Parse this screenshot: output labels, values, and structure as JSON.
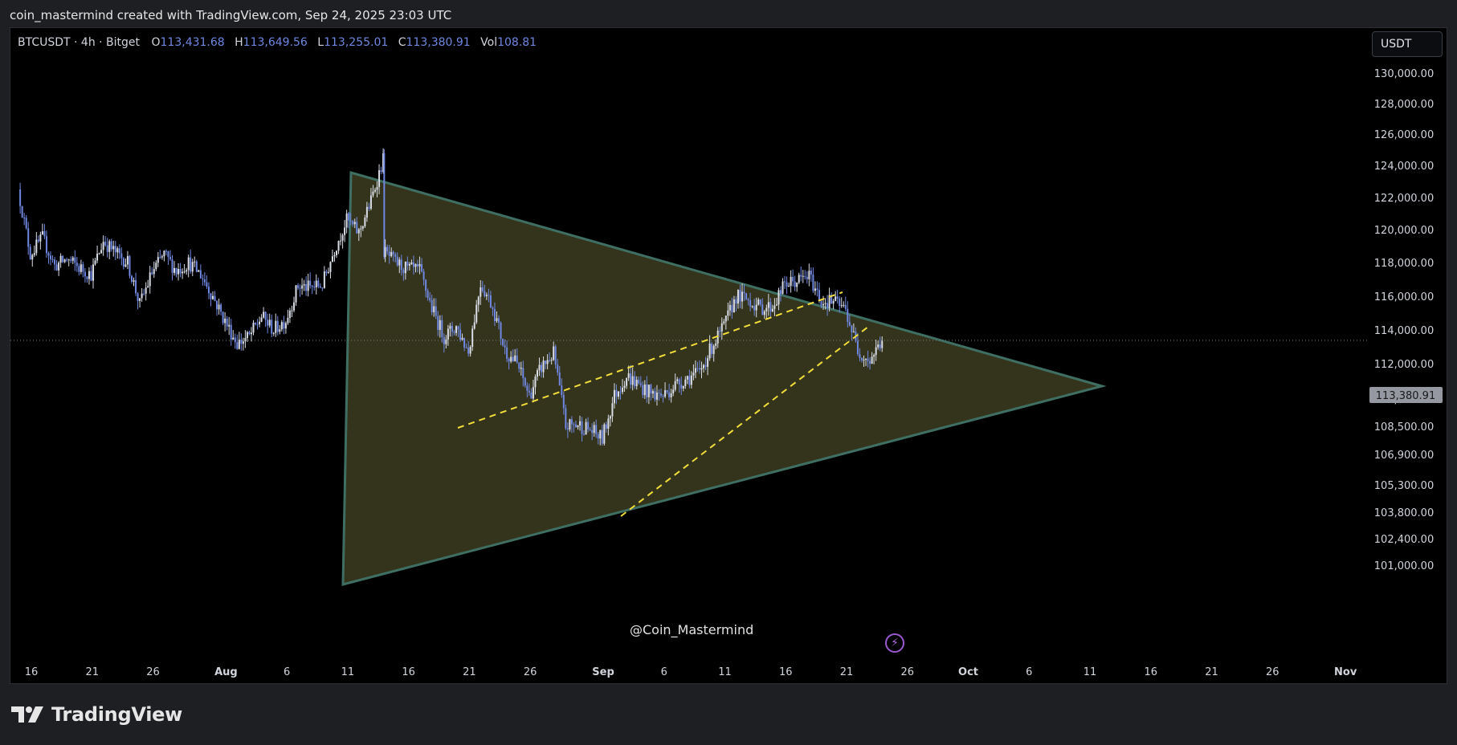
{
  "header": {
    "attribution": "coin_mastermind created with TradingView.com, Sep 24, 2025 23:03 UTC"
  },
  "symbol_info": {
    "symbol": "BTCUSDT · 4h · Bitget",
    "open_label": "O",
    "open": "113,431.68",
    "high_label": "H",
    "high": "113,649.56",
    "low_label": "L",
    "low": "113,255.01",
    "close_label": "C",
    "close": "113,380.91",
    "vol_label": "Vol",
    "vol": "108.81"
  },
  "currency_button": "USDT",
  "watermark": "@Coin_Mastermind",
  "logo": {
    "name": "TradingView",
    "icon": "tradingview-logo-icon"
  },
  "colors": {
    "background": "#000000",
    "candle": "#6f87e0",
    "candle_alt": "#d9dde6",
    "triangle_fill": "#3a3a20",
    "triangle_stroke": "#3f6f62",
    "dashed_line": "#f2dd3a",
    "price_line": "#7a7f88",
    "price_tag": "#9598a1"
  },
  "chart_data": {
    "type": "candlestick",
    "title": "BTCUSDT · 4h · Bitget",
    "timeframe": "4h",
    "y_ticks": [
      130000,
      128000,
      126000,
      124000,
      122000,
      120000,
      118000,
      116000,
      114000,
      112000,
      110000,
      108500,
      106900,
      105300,
      103800,
      102400,
      101000
    ],
    "y_tick_labels": [
      "130,000.00",
      "128,000.00",
      "126,000.00",
      "124,000.00",
      "122,000.00",
      "120,000.00",
      "118,000.00",
      "116,000.00",
      "114,000.00",
      "112,000.00",
      "110,000.00",
      "108,500.00",
      "106,900.00",
      "105,300.00",
      "103,800.00",
      "102,400.00",
      "101,000.00"
    ],
    "x_tick_labels": [
      "16",
      "21",
      "26",
      "Aug",
      "6",
      "11",
      "16",
      "21",
      "26",
      "Sep",
      "6",
      "11",
      "16",
      "21",
      "26",
      "Oct",
      "6",
      "11",
      "16",
      "21",
      "26",
      "Nov"
    ],
    "x_tick_dates": [
      "2025-07-16",
      "2025-07-21",
      "2025-07-26",
      "2025-08-01",
      "2025-08-06",
      "2025-08-11",
      "2025-08-16",
      "2025-08-21",
      "2025-08-26",
      "2025-09-01",
      "2025-09-06",
      "2025-09-11",
      "2025-09-16",
      "2025-09-21",
      "2025-09-26",
      "2025-10-01",
      "2025-10-06",
      "2025-10-11",
      "2025-10-16",
      "2025-10-21",
      "2025-10-26",
      "2025-11-01"
    ],
    "last_price": 113380.91,
    "last_price_label": "113,380.91",
    "price_path": [
      [
        "2025-07-15",
        122500
      ],
      [
        "2025-07-16",
        118500
      ],
      [
        "2025-07-17",
        119500
      ],
      [
        "2025-07-18",
        117800
      ],
      [
        "2025-07-19",
        118200
      ],
      [
        "2025-07-20",
        117700
      ],
      [
        "2025-07-21",
        117300
      ],
      [
        "2025-07-22",
        119300
      ],
      [
        "2025-07-23",
        118600
      ],
      [
        "2025-07-24",
        118000
      ],
      [
        "2025-07-25",
        115500
      ],
      [
        "2025-07-26",
        117400
      ],
      [
        "2025-07-27",
        118500
      ],
      [
        "2025-07-28",
        117500
      ],
      [
        "2025-07-29",
        118000
      ],
      [
        "2025-07-30",
        117300
      ],
      [
        "2025-07-31",
        116000
      ],
      [
        "2025-08-01",
        114500
      ],
      [
        "2025-08-02",
        113200
      ],
      [
        "2025-08-03",
        113600
      ],
      [
        "2025-08-04",
        114800
      ],
      [
        "2025-08-05",
        114000
      ],
      [
        "2025-08-06",
        114600
      ],
      [
        "2025-08-07",
        116600
      ],
      [
        "2025-08-08",
        116500
      ],
      [
        "2025-08-09",
        116700
      ],
      [
        "2025-08-10",
        118800
      ],
      [
        "2025-08-11",
        120600
      ],
      [
        "2025-08-12",
        119800
      ],
      [
        "2025-08-13",
        121800
      ],
      [
        "2025-08-14",
        124400
      ],
      [
        "2025-08-14",
        118700
      ],
      [
        "2025-08-15",
        118000
      ],
      [
        "2025-08-16",
        117600
      ],
      [
        "2025-08-17",
        117500
      ],
      [
        "2025-08-18",
        115300
      ],
      [
        "2025-08-19",
        113600
      ],
      [
        "2025-08-20",
        114200
      ],
      [
        "2025-08-21",
        112700
      ],
      [
        "2025-08-22",
        116800
      ],
      [
        "2025-08-23",
        115400
      ],
      [
        "2025-08-24",
        112800
      ],
      [
        "2025-08-25",
        112000
      ],
      [
        "2025-08-26",
        110200
      ],
      [
        "2025-08-27",
        111800
      ],
      [
        "2025-08-28",
        112600
      ],
      [
        "2025-08-29",
        108500
      ],
      [
        "2025-08-30",
        108600
      ],
      [
        "2025-08-31",
        108300
      ],
      [
        "2025-09-01",
        107800
      ],
      [
        "2025-09-02",
        110200
      ],
      [
        "2025-09-03",
        111300
      ],
      [
        "2025-09-04",
        110800
      ],
      [
        "2025-09-05",
        110300
      ],
      [
        "2025-09-06",
        110200
      ],
      [
        "2025-09-07",
        110800
      ],
      [
        "2025-09-08",
        111200
      ],
      [
        "2025-09-09",
        111500
      ],
      [
        "2025-09-10",
        113000
      ],
      [
        "2025-09-11",
        114200
      ],
      [
        "2025-09-12",
        116000
      ],
      [
        "2025-09-13",
        115800
      ],
      [
        "2025-09-14",
        115300
      ],
      [
        "2025-09-15",
        115400
      ],
      [
        "2025-09-16",
        116700
      ],
      [
        "2025-09-17",
        116900
      ],
      [
        "2025-09-18",
        117200
      ],
      [
        "2025-09-19",
        115700
      ],
      [
        "2025-09-20",
        115700
      ],
      [
        "2025-09-21",
        115200
      ],
      [
        "2025-09-22",
        112800
      ],
      [
        "2025-09-23",
        112200
      ],
      [
        "2025-09-24",
        113400
      ]
    ]
  }
}
